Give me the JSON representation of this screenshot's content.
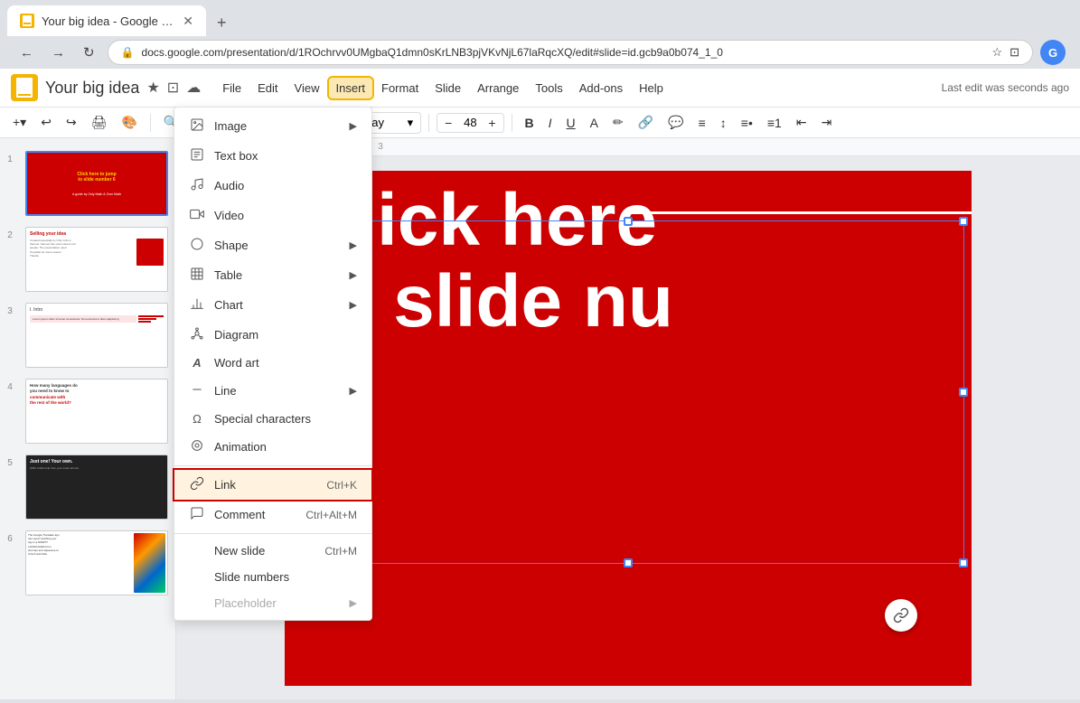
{
  "browser": {
    "tab_title": "Your big idea - Google Slides",
    "address": "docs.google.com/presentation/d/1ROchrvv0UMgbaQ1dmn0sKrLNB3pjVKvNjL67laRqcXQ/edit#slide=id.gcb9a0b074_1_0",
    "new_tab_label": "+",
    "nav_back": "←",
    "nav_forward": "→",
    "nav_refresh": "↻"
  },
  "app": {
    "logo_letter": "G",
    "title": "Your big idea",
    "last_edit": "Last edit was seconds ago",
    "menus": [
      "File",
      "Edit",
      "View",
      "Insert",
      "Format",
      "Slide",
      "Arrange",
      "Tools",
      "Add-ons",
      "Help"
    ],
    "insert_label": "Insert"
  },
  "toolbar": {
    "font_name": "Raleway",
    "font_size": "48",
    "bold": "B",
    "italic": "I",
    "underline": "U"
  },
  "slides": [
    {
      "num": "1",
      "type": "red-title"
    },
    {
      "num": "2",
      "type": "selling"
    },
    {
      "num": "3",
      "type": "intro"
    },
    {
      "num": "4",
      "type": "languages"
    },
    {
      "num": "5",
      "type": "dark"
    },
    {
      "num": "6",
      "type": "flags"
    }
  ],
  "slide_content": {
    "line1": "Click here",
    "line2": "to slide nu"
  },
  "insert_menu": {
    "items": [
      {
        "id": "image",
        "icon": "🖼",
        "label": "Image",
        "has_arrow": true,
        "shortcut": "",
        "highlighted": false,
        "disabled": false
      },
      {
        "id": "text-box",
        "icon": "⬜",
        "label": "Text box",
        "has_arrow": false,
        "shortcut": "",
        "highlighted": false,
        "disabled": false
      },
      {
        "id": "audio",
        "icon": "🎵",
        "label": "Audio",
        "has_arrow": false,
        "shortcut": "",
        "highlighted": false,
        "disabled": false
      },
      {
        "id": "video",
        "icon": "▶",
        "label": "Video",
        "has_arrow": false,
        "shortcut": "",
        "highlighted": false,
        "disabled": false
      },
      {
        "id": "shape",
        "icon": "⬡",
        "label": "Shape",
        "has_arrow": true,
        "shortcut": "",
        "highlighted": false,
        "disabled": false
      },
      {
        "id": "table",
        "icon": "⊞",
        "label": "Table",
        "has_arrow": true,
        "shortcut": "",
        "highlighted": false,
        "disabled": false
      },
      {
        "id": "chart",
        "icon": "📊",
        "label": "Chart",
        "has_arrow": true,
        "shortcut": "",
        "highlighted": false,
        "disabled": false
      },
      {
        "id": "diagram",
        "icon": "⊕",
        "label": "Diagram",
        "has_arrow": false,
        "shortcut": "",
        "highlighted": false,
        "disabled": false
      },
      {
        "id": "word-art",
        "icon": "A",
        "label": "Word art",
        "has_arrow": false,
        "shortcut": "",
        "highlighted": false,
        "disabled": false
      },
      {
        "id": "line",
        "icon": "⁄",
        "label": "Line",
        "has_arrow": true,
        "shortcut": "",
        "highlighted": false,
        "disabled": false
      },
      {
        "id": "special-chars",
        "icon": "Ω",
        "label": "Special characters",
        "has_arrow": false,
        "shortcut": "",
        "highlighted": false,
        "disabled": false
      },
      {
        "id": "animation",
        "icon": "◎",
        "label": "Animation",
        "has_arrow": false,
        "shortcut": "",
        "highlighted": false,
        "disabled": false
      }
    ],
    "divider_after": [
      "animation"
    ],
    "bottom_items": [
      {
        "id": "link",
        "icon": "🔗",
        "label": "Link",
        "shortcut": "Ctrl+K",
        "highlighted": true,
        "disabled": false
      },
      {
        "id": "comment",
        "icon": "💬",
        "label": "Comment",
        "shortcut": "Ctrl+Alt+M",
        "highlighted": false,
        "disabled": false
      },
      {
        "id": "divider2",
        "type": "divider"
      },
      {
        "id": "new-slide",
        "label": "New slide",
        "shortcut": "Ctrl+M",
        "highlighted": false,
        "disabled": false
      },
      {
        "id": "slide-numbers",
        "label": "Slide numbers",
        "shortcut": "",
        "highlighted": false,
        "disabled": false
      },
      {
        "id": "placeholder",
        "label": "Placeholder",
        "shortcut": "",
        "has_arrow": true,
        "highlighted": false,
        "disabled": true
      }
    ]
  }
}
